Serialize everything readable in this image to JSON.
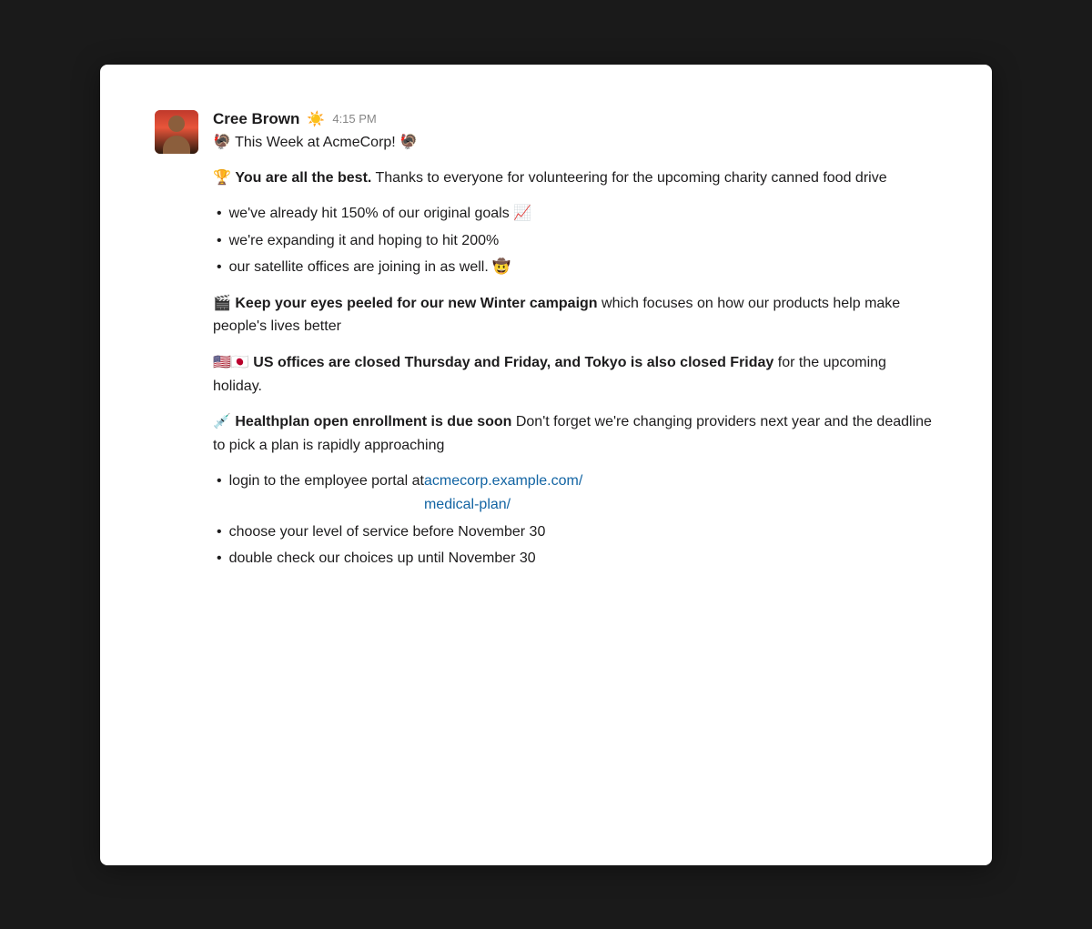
{
  "message": {
    "sender": {
      "name": "Cree Brown",
      "status_emoji": "☀️",
      "timestamp": "4:15 PM",
      "avatar_alt": "Cree Brown profile photo"
    },
    "subject": "🦃 This Week at AcmeCorp! 🦃",
    "sections": [
      {
        "id": "best",
        "type": "paragraph",
        "content": "🏆 **You are all the best.** Thanks to everyone for volunteering for the upcoming charity canned food drive"
      },
      {
        "id": "goals",
        "type": "bullets",
        "items": [
          "we've already hit 150% of our original goals 📈",
          "we're expanding it and hoping to hit 200%",
          "our satellite offices are joining in as well. 🤠"
        ]
      },
      {
        "id": "winter",
        "type": "paragraph",
        "content": "🎬 **Keep your eyes peeled for our new Winter campaign** which focuses on how our products help make people's lives better"
      },
      {
        "id": "offices",
        "type": "paragraph",
        "content": "🇺🇸🇯🇵 **US offices are closed Thursday and Friday, and Tokyo is also closed Friday** for the upcoming holiday."
      },
      {
        "id": "healthplan",
        "type": "paragraph",
        "content": "💉 **Healthplan open enrollment is due soon** Don't forget we're changing providers next year and the deadline to pick a plan is rapidly approaching"
      },
      {
        "id": "healthplan-bullets",
        "type": "mixed_bullets",
        "items": [
          {
            "text_before": "login to the employee portal at ",
            "link": "acmecorp.example.com/medical-plan/",
            "link_href": "acmecorp.example.com/medical-plan/",
            "text_after": ""
          },
          {
            "text": "choose your level of service before November 30",
            "link": null
          },
          {
            "text": "double check our choices up until November 30",
            "link": null
          }
        ]
      }
    ],
    "link_color": "#1264a3"
  }
}
